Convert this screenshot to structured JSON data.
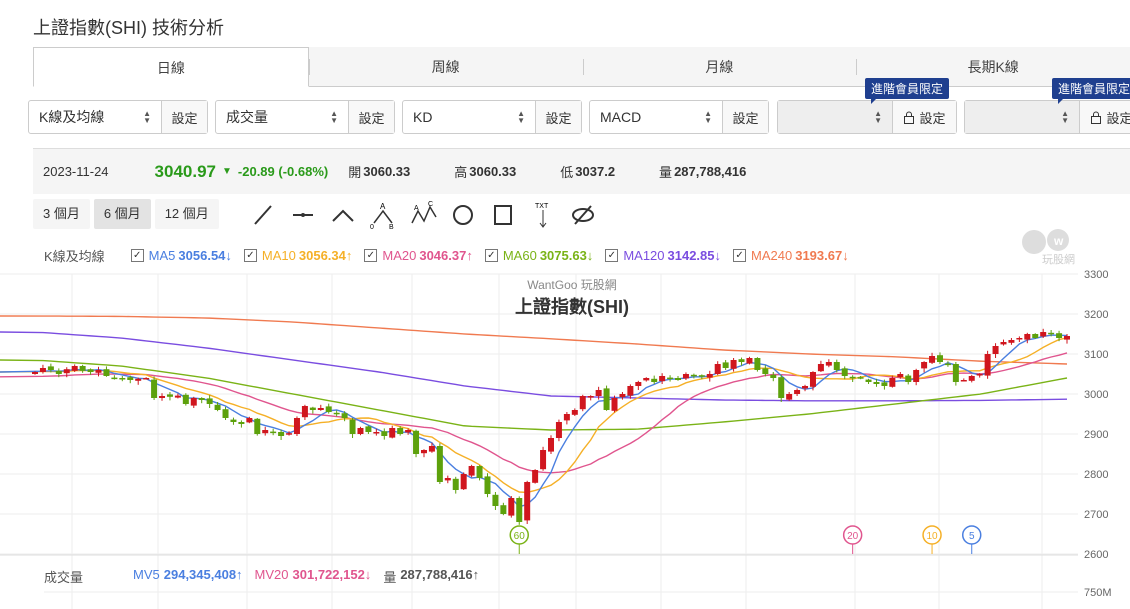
{
  "title": "上證指數(SHI) 技術分析",
  "tabs": [
    "日線",
    "周線",
    "月線",
    "長期K線"
  ],
  "controls": [
    {
      "value": "K線及均線",
      "button": "設定"
    },
    {
      "value": "成交量",
      "button": "設定"
    },
    {
      "value": "KD",
      "button": "設定"
    },
    {
      "value": "MACD",
      "button": "設定"
    },
    {
      "value": "",
      "button": "設定",
      "badge": "進階會員限定"
    },
    {
      "value": "",
      "button": "設定",
      "badge": "進階會員限定"
    }
  ],
  "quote": {
    "date": "2023-11-24",
    "price": "3040.97",
    "change": "-20.89 (-0.68%)",
    "open_label": "開",
    "open": "3060.33",
    "high_label": "高",
    "high": "3060.33",
    "low_label": "低",
    "low": "3037.2",
    "vol_label": "量",
    "vol": "287,788,416"
  },
  "ranges": [
    "3 個月",
    "6 個月",
    "12 個月"
  ],
  "legend": {
    "label": "K線及均線",
    "items": [
      {
        "name": "MA5",
        "value": "3056.54↓",
        "color": "#4a7fe0"
      },
      {
        "name": "MA10",
        "value": "3056.34↑",
        "color": "#f5b027"
      },
      {
        "name": "MA20",
        "value": "3046.37↑",
        "color": "#e0558e"
      },
      {
        "name": "MA60",
        "value": "3075.63↓",
        "color": "#7ab317"
      },
      {
        "name": "MA120",
        "value": "3142.85↓",
        "color": "#7a4de0"
      },
      {
        "name": "MA240",
        "value": "3193.67↓",
        "color": "#f07a50"
      }
    ]
  },
  "logo_text": "玩股網",
  "volume": {
    "label": "成交量",
    "mv5_label": "MV5",
    "mv5": "294,345,408↑",
    "mv20_label": "MV20",
    "mv20": "301,722,152↓",
    "vol_label": "量",
    "vol": "287,788,416↑",
    "axis": "750M"
  },
  "colors": {
    "up": "#d0161e",
    "down": "#5da10c"
  },
  "chart_data": {
    "type": "candlestick",
    "watermark": "WantGoo 玩股網",
    "title": "上證指數(SHI)",
    "ylim": [
      2600,
      3300
    ],
    "yticks": [
      "3300",
      "3200",
      "3100",
      "3000",
      "2900",
      "2800",
      "2700",
      "2600"
    ],
    "closes": [
      3055,
      3065,
      3060,
      3050,
      3062,
      3070,
      3058,
      3055,
      3060,
      3045,
      3040,
      3038,
      3035,
      3038,
      3040,
      2990,
      2995,
      2993,
      2996,
      2975,
      2990,
      2985,
      2975,
      2960,
      2940,
      2930,
      2925,
      2940,
      2900,
      2910,
      2905,
      2895,
      2902,
      2940,
      2970,
      2960,
      2965,
      2955,
      2950,
      2940,
      2900,
      2915,
      2905,
      2905,
      2895,
      2915,
      2900,
      2910,
      2850,
      2860,
      2870,
      2780,
      2790,
      2760,
      2800,
      2820,
      2790,
      2750,
      2720,
      2700,
      2740,
      2680,
      2780,
      2810,
      2860,
      2890,
      2930,
      2950,
      2960,
      2995,
      2995,
      3010,
      2960,
      2990,
      3000,
      3020,
      3030,
      3040,
      3030,
      3045,
      3040,
      3035,
      3050,
      3045,
      3045,
      3050,
      3075,
      3065,
      3085,
      3080,
      3090,
      3060,
      3050,
      3040,
      2990,
      3000,
      3010,
      3020,
      3055,
      3075,
      3080,
      3060,
      3045,
      3040,
      3040,
      3030,
      3025,
      3020,
      3040,
      3050,
      3030,
      3060,
      3080,
      3095,
      3080,
      3075,
      3030,
      3035,
      3045,
      3050,
      3100,
      3120,
      3130,
      3135,
      3140,
      3150,
      3140,
      3155,
      3150,
      3140,
      3145
    ],
    "ma60": [
      3085,
      3070,
      3040,
      3000,
      2960,
      2920,
      2910,
      2912,
      2930,
      2950,
      2975,
      3000,
      3040
    ],
    "ma120": [
      3155,
      3140,
      3115,
      3085,
      3055,
      3020,
      2995,
      2990,
      2985,
      2983,
      2983,
      2984,
      2987
    ],
    "ma240": [
      3195,
      3194,
      3190,
      3180,
      3165,
      3150,
      3138,
      3125,
      3110,
      3100,
      3093,
      3082,
      3075
    ],
    "markers": [
      {
        "label": "60",
        "color": "#7ab317",
        "index": 61
      },
      {
        "label": "20",
        "color": "#e0558e",
        "index": 103
      },
      {
        "label": "10",
        "color": "#f5b027",
        "index": 113
      },
      {
        "label": "5",
        "color": "#4a7fe0",
        "index": 118
      }
    ]
  }
}
